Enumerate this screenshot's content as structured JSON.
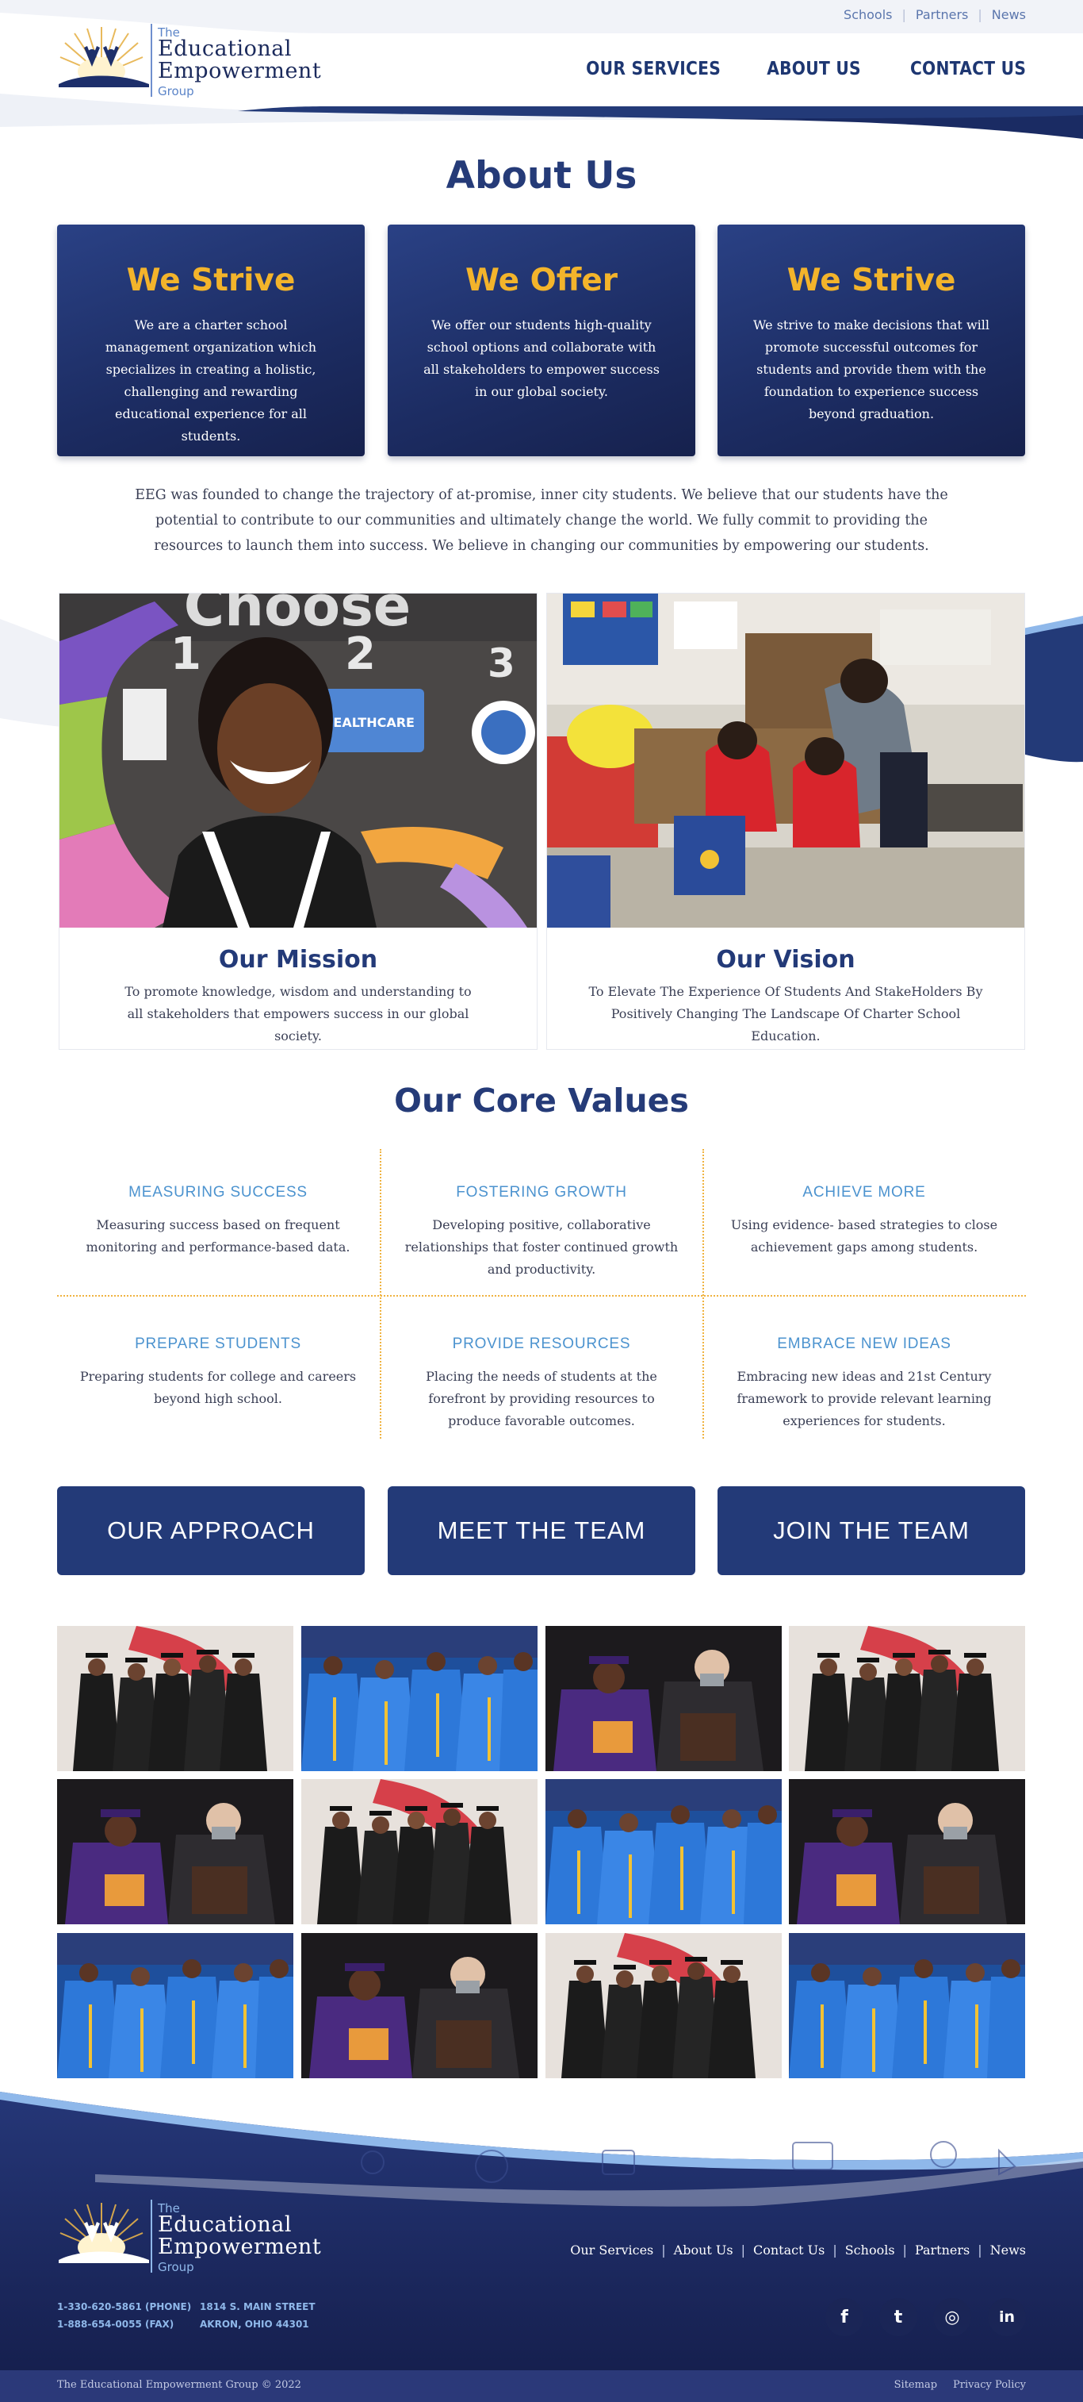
{
  "header": {
    "top_links": [
      "Schools",
      "Partners",
      "News"
    ],
    "logo": {
      "line1": "The",
      "line2": "Educational",
      "line3": "Empowerment",
      "line4": "Group"
    },
    "nav": [
      "OUR SERVICES",
      "ABOUT US",
      "CONTACT US"
    ]
  },
  "about": {
    "title": "About Us",
    "cards": [
      {
        "title": "We Strive",
        "text": "We are a charter school management organization which specializes in creating a holistic, challenging and rewarding educational experience for all students."
      },
      {
        "title": "We Offer",
        "text": "We offer our students high-quality school options and collaborate with all stakeholders to empower success in our global society."
      },
      {
        "title": "We Strive",
        "text": "We strive to make decisions that will promote successful outcomes for students and provide them with the foundation to experience success beyond graduation."
      }
    ],
    "intro": "EEG was founded to change the trajectory of at-promise, inner city students. We believe that our students have the potential to contribute to our communities and ultimately change the world. We fully commit to providing the resources to launch them into success. We believe in changing our communities by empowering our students."
  },
  "mission": {
    "title": "Our Mission",
    "text": "To promote knowledge, wisdom and understanding to all stakeholders that empowers success in our global society.",
    "photo_text": {
      "word": "Choose",
      "nums": [
        "1",
        "2",
        "3"
      ],
      "sign": "HEALTHCARE"
    }
  },
  "vision": {
    "title": "Our Vision",
    "text": "To Elevate The Experience Of Students And StakeHolders By Positively Changing The Landscape Of Charter School Education."
  },
  "core_values": {
    "title": "Our Core Values",
    "items": [
      {
        "heading": "MEASURING SUCCESS",
        "text": "Measuring success based on frequent monitoring and performance-based data."
      },
      {
        "heading": "FOSTERING GROWTH",
        "text": "Developing positive, collaborative relationships that foster continued growth and productivity."
      },
      {
        "heading": "ACHIEVE MORE",
        "text": "Using evidence- based strategies to close achievement gaps among students."
      },
      {
        "heading": "PREPARE STUDENTS",
        "text": "Preparing students for college and careers beyond high school."
      },
      {
        "heading": "PROVIDE RESOURCES",
        "text": "Placing the needs of students at the forefront by providing resources to produce favorable outcomes."
      },
      {
        "heading": "EMBRACE NEW IDEAS",
        "text": "Embracing new ideas and 21st Century framework to provide relevant learning experiences for students."
      }
    ]
  },
  "cta_buttons": [
    "OUR APPROACH",
    "MEET THE TEAM",
    "JOIN THE TEAM"
  ],
  "gallery": {
    "photos": [
      "black-gowns",
      "blue-gowns",
      "award",
      "black-gowns",
      "award",
      "black-gowns",
      "blue-gowns",
      "award",
      "blue-gowns",
      "award",
      "black-gowns",
      "blue-gowns"
    ]
  },
  "footer": {
    "logo": {
      "line1": "The",
      "line2": "Educational",
      "line3": "Empowerment",
      "line4": "Group"
    },
    "links": [
      "Our Services",
      "About Us",
      "Contact Us",
      "Schools",
      "Partners",
      "News"
    ],
    "phone": "1-330-620-5861 (PHONE)",
    "fax": "1-888-654-0055 (FAX)",
    "street": "1814 S. MAIN STREET",
    "city": "AKRON, OHIO 44301",
    "social": [
      {
        "icon": "facebook-icon",
        "glyph": "f"
      },
      {
        "icon": "twitter-icon",
        "glyph": "t"
      },
      {
        "icon": "instagram-icon",
        "glyph": "◎"
      },
      {
        "icon": "linkedin-icon",
        "glyph": "in"
      }
    ],
    "copyright": "The Educational Empowerment Group © 2022",
    "legal": [
      "Sitemap",
      "Privacy Policy"
    ]
  },
  "colors": {
    "navy": "#233a78",
    "gold": "#f3b42b",
    "light_blue": "#4c93cf",
    "footer_bar": "#2b3979"
  }
}
